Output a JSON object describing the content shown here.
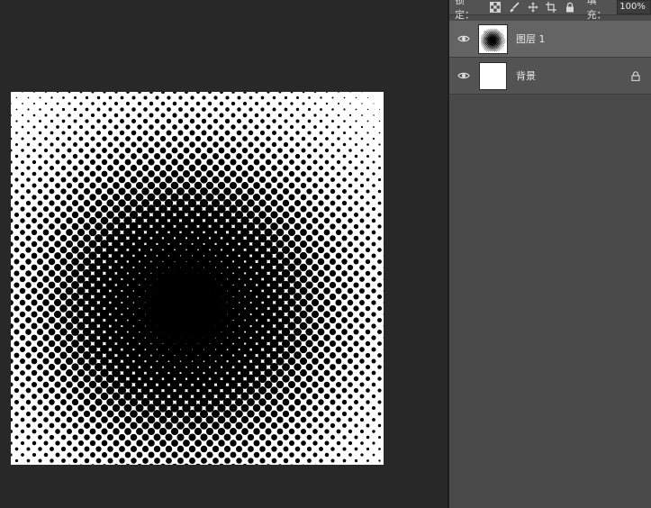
{
  "lock_bar": {
    "label": "锁定：",
    "icons": [
      "lock-transparent-pixels-icon",
      "lock-image-pixels-icon",
      "lock-position-icon",
      "lock-artboard-icon",
      "lock-all-icon"
    ],
    "fill_label": "填充：",
    "fill_value": "100%"
  },
  "layers": [
    {
      "name": "图层 1",
      "selected": true,
      "visible": true,
      "thumbnail": "halftone-dots",
      "locked": false
    },
    {
      "name": "背景",
      "selected": false,
      "visible": true,
      "thumbnail": "white",
      "locked": true
    }
  ],
  "canvas": {
    "content": "radial-halftone-dots",
    "background": "#ffffff",
    "dot_color": "#000000"
  },
  "colors": {
    "workspace": "#282828",
    "panel": "#4a4a4a",
    "selected_row": "#646464",
    "row": "#535353"
  }
}
